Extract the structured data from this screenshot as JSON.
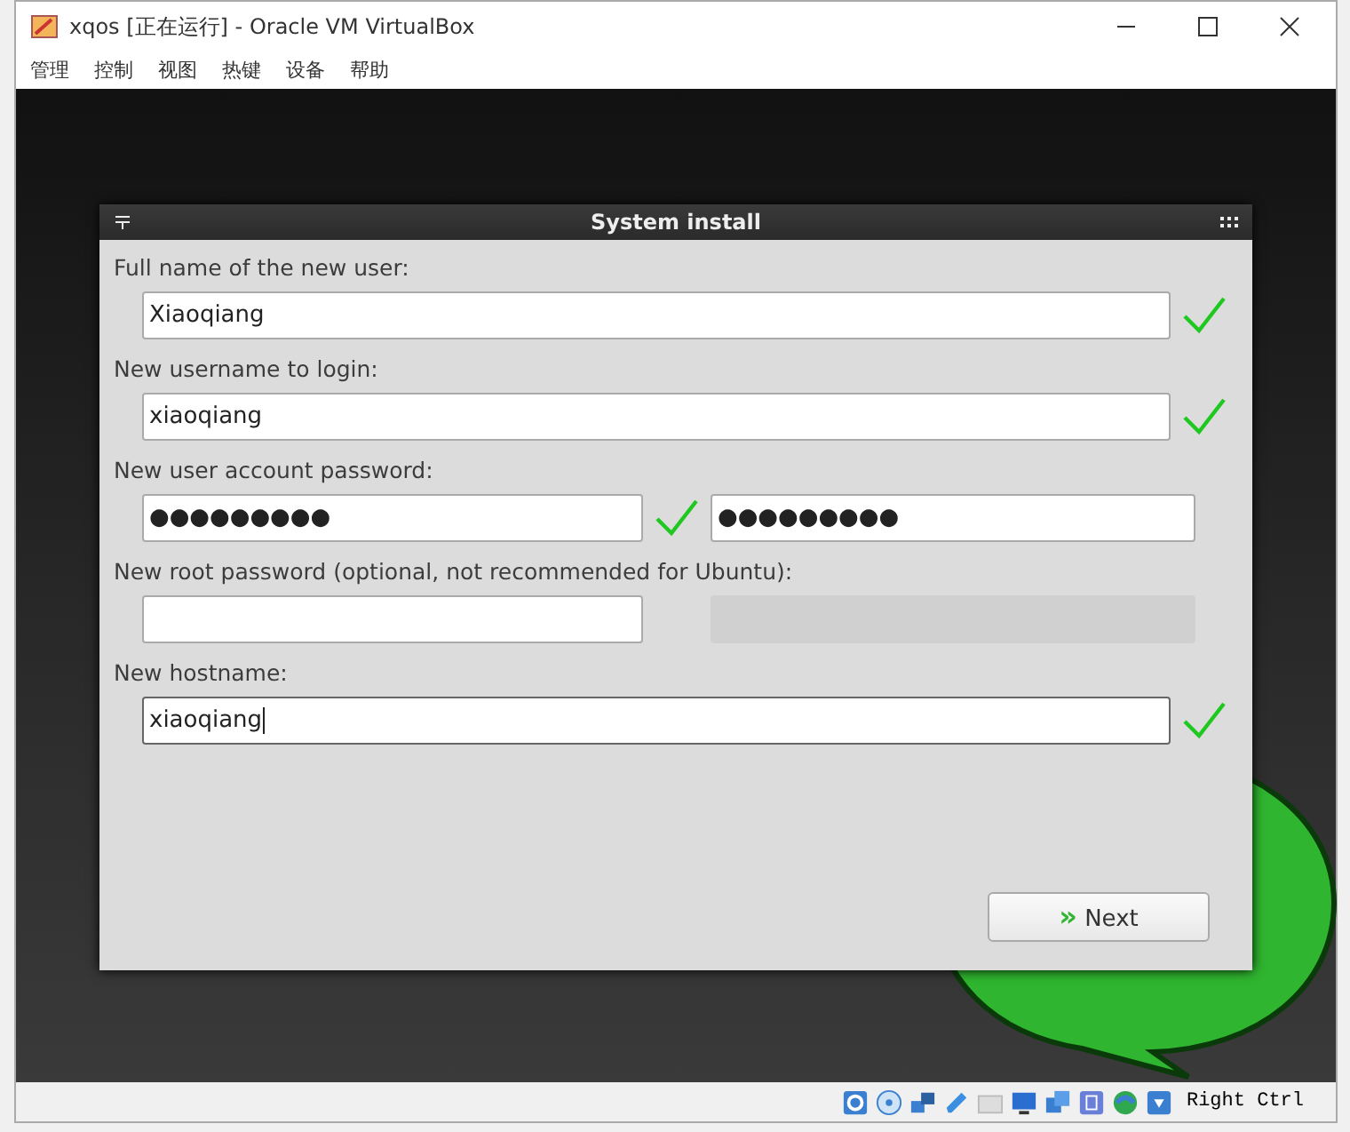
{
  "window": {
    "title": "xqos [正在运行] - Oracle VM VirtualBox",
    "menu": [
      "管理",
      "控制",
      "视图",
      "热键",
      "设备",
      "帮助"
    ]
  },
  "dialog": {
    "title": "System install",
    "fields": [
      {
        "label": "Full name of the new user:",
        "inputs": [
          {
            "value": "Xiaoqiang",
            "disabled": false,
            "valid": true,
            "focused": false
          }
        ]
      },
      {
        "label": "New username to login:",
        "inputs": [
          {
            "value": "xiaoqiang",
            "disabled": false,
            "valid": true,
            "focused": false
          }
        ]
      },
      {
        "label": "New user account password:",
        "inputs": [
          {
            "value": "●●●●●●●●●",
            "disabled": false,
            "valid": true,
            "focused": false
          },
          {
            "value": "●●●●●●●●●",
            "disabled": false,
            "valid": false,
            "focused": false
          }
        ]
      },
      {
        "label": "New root password (optional, not recommended for Ubuntu):",
        "inputs": [
          {
            "disabled": false,
            "valid": false,
            "focused": false
          },
          {
            "disabled": true,
            "valid": false,
            "focused": false
          }
        ]
      },
      {
        "label": "New hostname:",
        "inputs": [
          {
            "value": "xiaoqiang",
            "disabled": false,
            "valid": true,
            "focused": true
          }
        ]
      }
    ],
    "next_button": {
      "icon": "»",
      "label": "Next"
    }
  },
  "status_bar": {
    "host_key": "Right Ctrl"
  }
}
